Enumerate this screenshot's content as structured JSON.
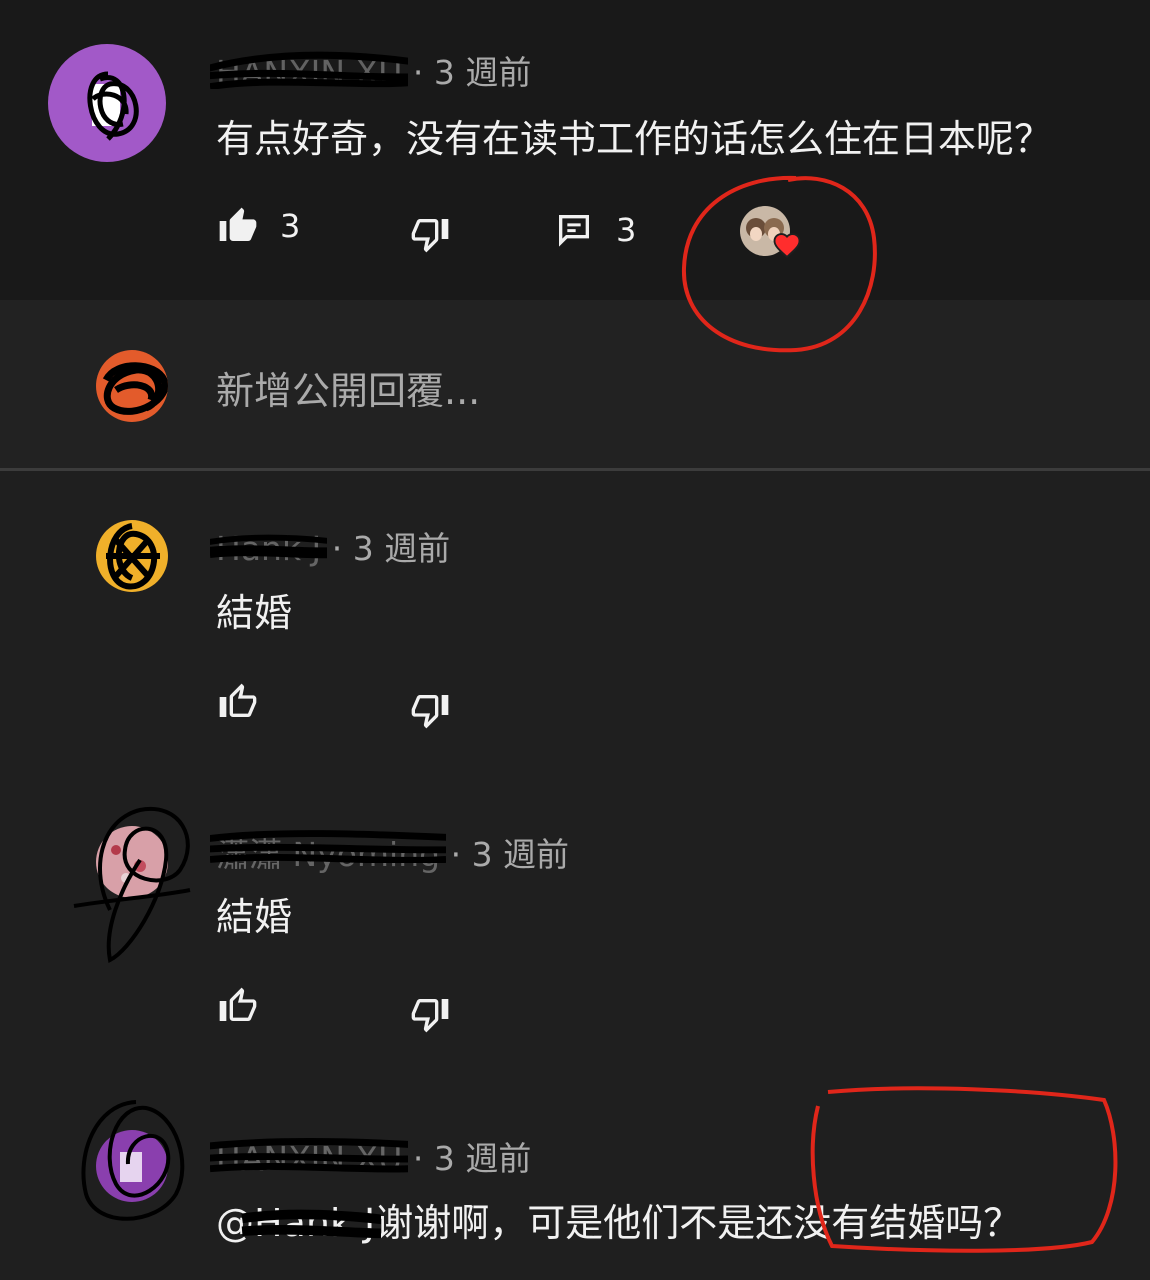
{
  "threads": {
    "top_comment": {
      "author": "HANXIN XU",
      "separator": "·",
      "timestamp": "3 週前",
      "text": "有点好奇，没有在读书工作的话怎么住在日本呢？",
      "like_count": "3",
      "reply_count": "3",
      "avatar_color": "#a259c8"
    },
    "reply_box": {
      "placeholder": "新增公開回覆..."
    },
    "replies": [
      {
        "author": "Hank J",
        "separator": "·",
        "timestamp": "3 週前",
        "text": "結婚"
      },
      {
        "author": "瀟瀟 Nyoming",
        "separator": "·",
        "timestamp": "3 週前",
        "text": "結婚"
      },
      {
        "author": "HANXIN XU",
        "separator": "·",
        "timestamp": "3 週前",
        "mention": "@Hank J",
        "text": "谢谢啊，可是他们不是还没有结婚吗？"
      }
    ]
  },
  "icons": {
    "like": "thumbs-up-icon",
    "dislike": "thumbs-down-icon",
    "reply": "comment-icon",
    "creator_heart": "creator-heart-icon"
  },
  "colors": {
    "annotation_red": "#e0261a",
    "heart_red": "#ff2d2d"
  }
}
